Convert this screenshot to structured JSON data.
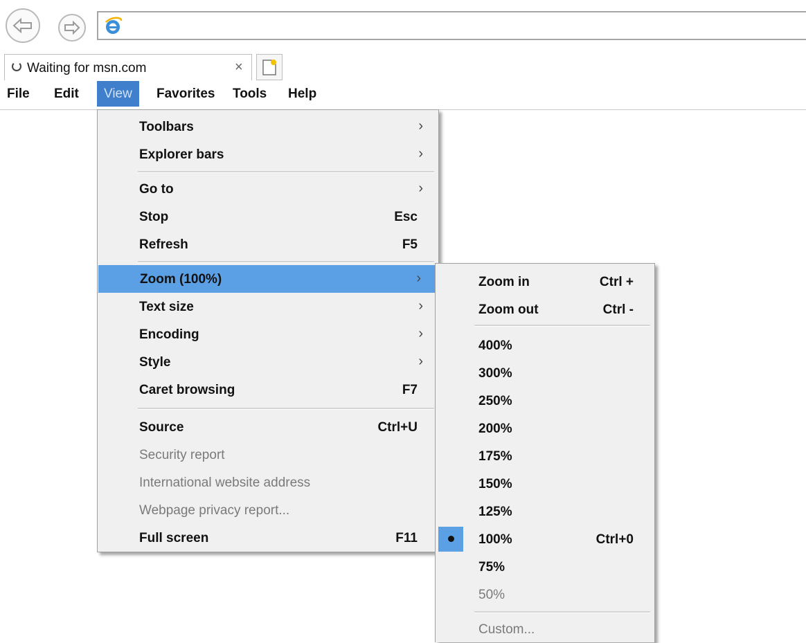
{
  "browser": {
    "back_icon": "back-arrow-icon",
    "forward_icon": "forward-arrow-icon",
    "address_icon": "ie-logo-icon",
    "address_value": ""
  },
  "tab": {
    "title": "Waiting for msn.com",
    "close": "×"
  },
  "menubar": {
    "items": [
      {
        "label": "File"
      },
      {
        "label": "Edit"
      },
      {
        "label": "View"
      },
      {
        "label": "Favorites"
      },
      {
        "label": "Tools"
      },
      {
        "label": "Help"
      }
    ],
    "active_color": "#3f7fcb"
  },
  "view_menu": {
    "items": [
      {
        "label": "Toolbars",
        "submenu": true
      },
      {
        "label": "Explorer bars",
        "submenu": true
      },
      {
        "label": "Go to",
        "submenu": true
      },
      {
        "label": "Stop",
        "shortcut": "Esc"
      },
      {
        "label": "Refresh",
        "shortcut": "F5"
      },
      {
        "label": "Zoom (100%)",
        "submenu": true,
        "highlighted": true
      },
      {
        "label": "Text size",
        "submenu": true
      },
      {
        "label": "Encoding",
        "submenu": true
      },
      {
        "label": "Style",
        "submenu": true
      },
      {
        "label": "Caret browsing",
        "shortcut": "F7"
      },
      {
        "label": "Source",
        "shortcut": "Ctrl+U"
      },
      {
        "label": "Security report",
        "disabled": true
      },
      {
        "label": "International website address",
        "disabled": true
      },
      {
        "label": "Webpage privacy report...",
        "disabled": true
      },
      {
        "label": "Full screen",
        "shortcut": "F11"
      }
    ],
    "arrow": "›",
    "highlight_color": "#5b9fe4"
  },
  "zoom_menu": {
    "items": [
      {
        "label": "Zoom in",
        "shortcut": "Ctrl +"
      },
      {
        "label": "Zoom out",
        "shortcut": "Ctrl -"
      },
      {
        "label": "400%"
      },
      {
        "label": "300%"
      },
      {
        "label": "250%"
      },
      {
        "label": "200%"
      },
      {
        "label": "175%"
      },
      {
        "label": "150%"
      },
      {
        "label": "125%"
      },
      {
        "label": "100%",
        "shortcut": "Ctrl+0",
        "selected": true
      },
      {
        "label": "75%"
      },
      {
        "label": "50%",
        "disabled": true
      },
      {
        "label": "Custom...",
        "disabled": true
      }
    ]
  }
}
